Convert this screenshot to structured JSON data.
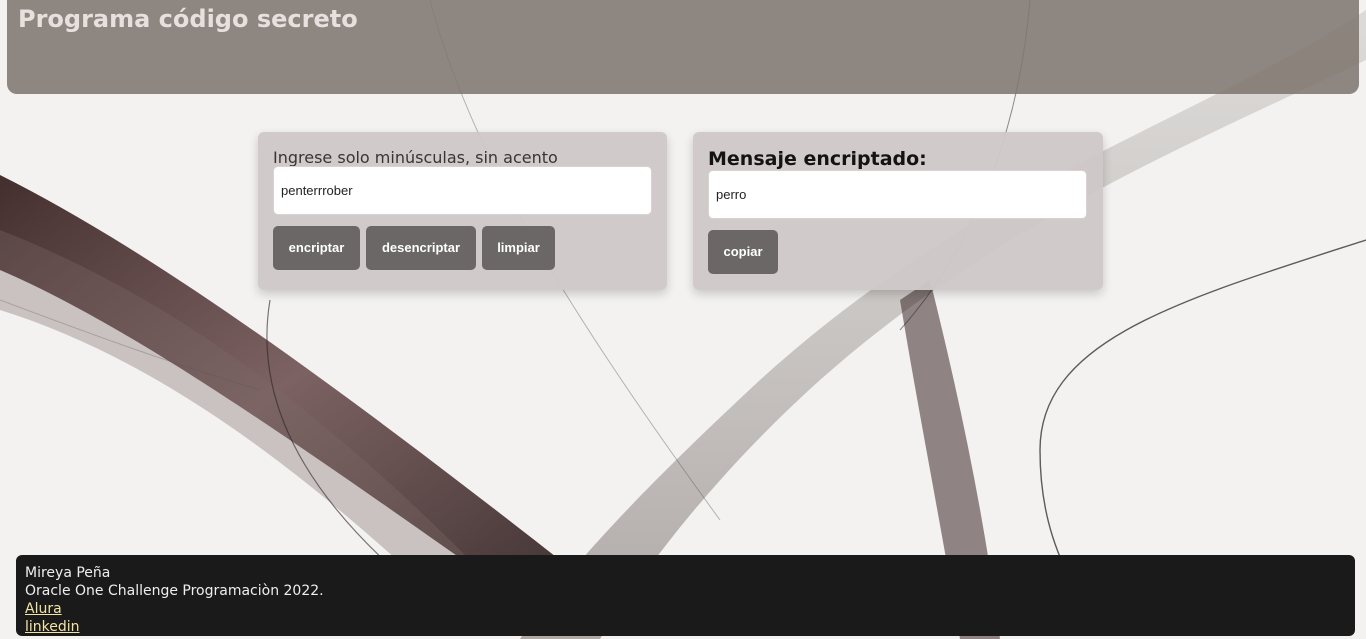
{
  "header": {
    "title": "Programa código secreto"
  },
  "encrypt_panel": {
    "instruction": "Ingrese solo minúsculas, sin acento",
    "input_value": "penterrrober",
    "buttons": {
      "encrypt": "encriptar",
      "decrypt": "desencriptar",
      "clear": "limpiar"
    }
  },
  "result_panel": {
    "title": "Mensaje encriptado:",
    "output_value": "perro",
    "copy_button": "copiar"
  },
  "footer": {
    "author": "Mireya Peña",
    "challenge": "Oracle One Challenge Programaciòn 2022.",
    "links": [
      "Alura",
      "linkedin"
    ]
  },
  "colors": {
    "header_bg": "#807670",
    "card_bg": "#cec8c8",
    "button_bg": "#6b6767",
    "footer_bg": "#1a1a1a",
    "footer_link": "#f1e4a4"
  }
}
